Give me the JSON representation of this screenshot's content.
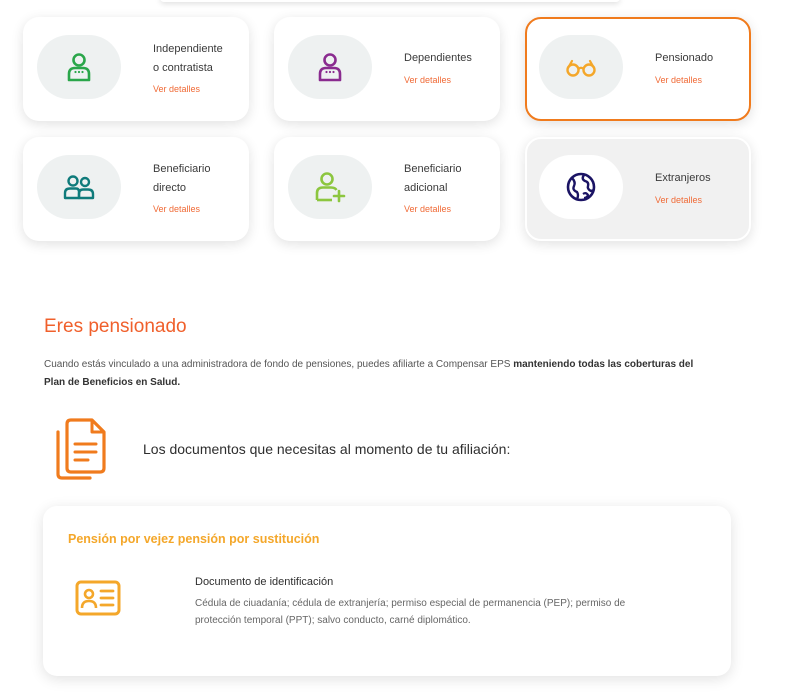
{
  "cards": [
    {
      "label_1": "Independiente",
      "label_2": "o contratista",
      "link": "Ver detalles",
      "icon": "person-icon",
      "color": "#2aa64a"
    },
    {
      "label_1": "Dependientes",
      "label_2": "",
      "link": "Ver detalles",
      "icon": "person-icon",
      "color": "#8a2b8f"
    },
    {
      "label_1": "Pensionado",
      "label_2": "",
      "link": "Ver detalles",
      "icon": "glasses-icon",
      "color": "#f4a72a"
    },
    {
      "label_1": "Beneficiario",
      "label_2": "directo",
      "link": "Ver detalles",
      "icon": "group-icon",
      "color": "#0f7b7b"
    },
    {
      "label_1": "Beneficiario",
      "label_2": "adicional",
      "link": "Ver detalles",
      "icon": "person-add-icon",
      "color": "#8cc63f"
    },
    {
      "label_1": "Extranjeros",
      "label_2": "",
      "link": "Ver detalles",
      "icon": "globe-icon",
      "color": "#1b1464"
    }
  ],
  "section": {
    "title": "Eres pensionado",
    "intro_plain": "Cuando estás vinculado a una administradora de fondo de pensiones, puedes afiliarte a Compensar EPS ",
    "intro_bold": "manteniendo todas las coberturas del Plan de Beneficios en Salud.",
    "docs_heading": "Los documentos que necesitas al momento de tu afiliación:"
  },
  "panel": {
    "title": "Pensión por vejez pensión por sustitución",
    "doc_title": "Documento de identificación",
    "doc_desc": "Cédula de ciuadanía; cédula de extranjería; permiso especial de permanencia (PEP); permiso de protección temporal (PPT); salvo conducto, carné diplomático."
  },
  "colors": {
    "accent": "#f0602c",
    "selected_border": "#f07b1d",
    "panel_title": "#f4a72a"
  }
}
